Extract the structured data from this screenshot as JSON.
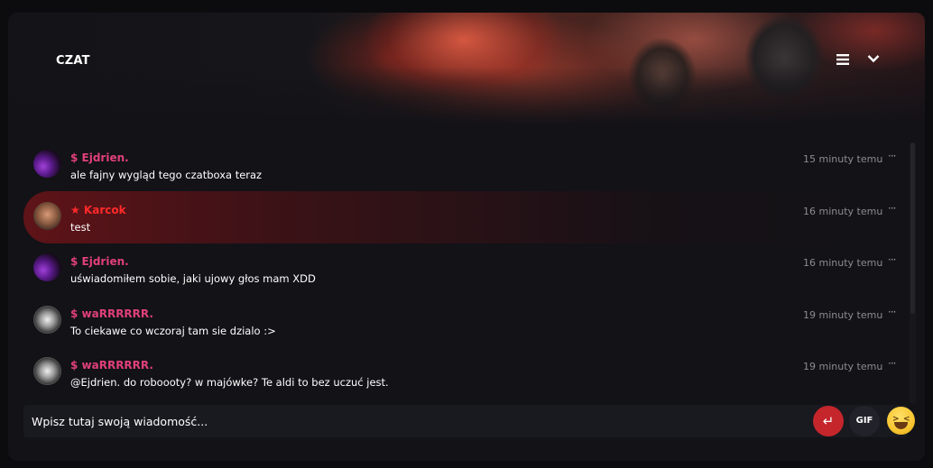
{
  "header": {
    "title": "CZAT",
    "icons": [
      "menu-icon",
      "chevron-down-icon"
    ]
  },
  "messages": [
    {
      "author": "$ Ejdrien.",
      "text": "ale fajny wygląd tego czatboxa teraz",
      "time": "15 minuty temu",
      "menu": "···",
      "avatar": "purple-avatar"
    },
    {
      "author": "★ Karcok",
      "text": "test",
      "time": "16 minuty temu",
      "menu": "···",
      "avatar": "face-avatar",
      "highlighted": true
    },
    {
      "author": "$ Ejdrien.",
      "text": "uświadomiłem sobie, jaki ujowy głos mam XDD",
      "time": "16 minuty temu",
      "menu": "···",
      "avatar": "purple-avatar"
    },
    {
      "author": "$ waRRRRRR.",
      "text": "To ciekawe co wczoraj tam sie dzialo :>",
      "time": "19 minuty temu",
      "menu": "···",
      "avatar": "mask-avatar"
    },
    {
      "author": "$ waRRRRRR.",
      "text": "@Ejdrien. do roboooty? w majówke? Te aldi to bez uczuć jest.",
      "time": "19 minuty temu",
      "menu": "···",
      "avatar": "mask-avatar"
    }
  ],
  "composer": {
    "placeholder": "Wpisz tutaj swoją wiadomość...",
    "send_icon": "↵",
    "gif_label": "GIF",
    "emoji_icon": "grinning-squint-emoji-icon"
  },
  "colors": {
    "accent": "#c4262b",
    "author_pink": "#e0407a",
    "author_red": "#ff2a2a",
    "background": "#121217"
  }
}
